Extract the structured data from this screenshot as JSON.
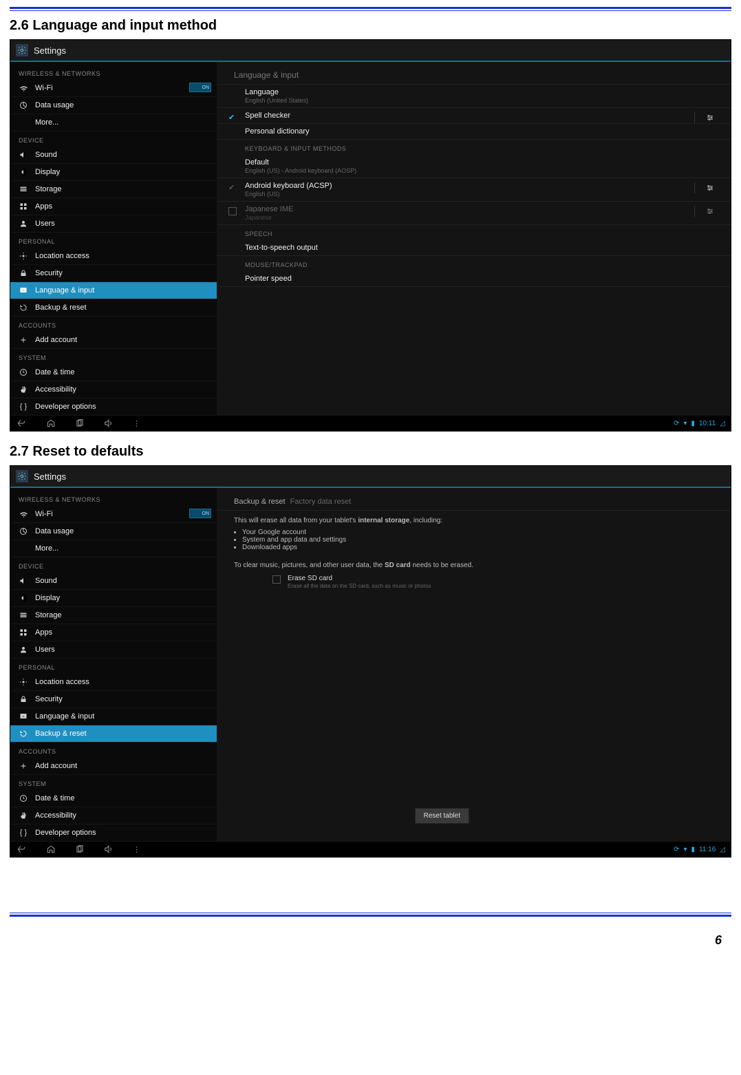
{
  "doc": {
    "heading1": "2.6 Language and input method",
    "heading2": "2.7 Reset to defaults",
    "page_number": "6"
  },
  "shot1": {
    "title": "Settings",
    "time": "10:11",
    "sidebar": {
      "cat_wireless": "WIRELESS & NETWORKS",
      "wifi": "Wi-Fi",
      "wifi_toggle": "ON",
      "data_usage": "Data usage",
      "more": "More...",
      "cat_device": "DEVICE",
      "sound": "Sound",
      "display": "Display",
      "storage": "Storage",
      "apps": "Apps",
      "users": "Users",
      "cat_personal": "PERSONAL",
      "location": "Location access",
      "security": "Security",
      "language": "Language & input",
      "backup": "Backup & reset",
      "cat_accounts": "ACCOUNTS",
      "add_account": "Add account",
      "cat_system": "SYSTEM",
      "datetime": "Date & time",
      "accessibility": "Accessibility",
      "developer": "Developer options"
    },
    "content": {
      "header": "Language & input",
      "language_label": "Language",
      "language_value": "English (United States)",
      "spell_checker": "Spell checker",
      "personal_dictionary": "Personal dictionary",
      "cat_keyboard": "KEYBOARD & INPUT METHODS",
      "default_label": "Default",
      "default_value": "English (US) - Android keyboard (AOSP)",
      "kb1_label": "Android keyboard (ACSP)",
      "kb1_sub": "English (US)",
      "kb2_label": "Japanese IME",
      "kb2_sub": "Japanese",
      "cat_speech": "SPEECH",
      "tts": "Text-to-speech output",
      "cat_mouse": "MOUSE/TRACKPAD",
      "pointer_speed": "Pointer speed"
    }
  },
  "shot2": {
    "title": "Settings",
    "time": "11:16",
    "sidebar": {
      "cat_wireless": "WIRELESS & NETWORKS",
      "wifi": "Wi-Fi",
      "wifi_toggle": "ON",
      "data_usage": "Data usage",
      "more": "More...",
      "cat_device": "DEVICE",
      "sound": "Sound",
      "display": "Display",
      "storage": "Storage",
      "apps": "Apps",
      "users": "Users",
      "cat_personal": "PERSONAL",
      "location": "Location access",
      "security": "Security",
      "language": "Language & input",
      "backup": "Backup & reset",
      "cat_accounts": "ACCOUNTS",
      "add_account": "Add account",
      "cat_system": "SYSTEM",
      "datetime": "Date & time",
      "accessibility": "Accessibility",
      "developer": "Developer options"
    },
    "content": {
      "breadcrumb1": "Backup & reset",
      "breadcrumb2": "Factory data reset",
      "para1_a": "This will erase all data from your tablet's ",
      "para1_b": "internal storage",
      "para1_c": ", including:",
      "b1": "Your Google account",
      "b2": "System and app data and settings",
      "b3": "Downloaded apps",
      "para2_a": "To clear music, pictures, and other user data, the ",
      "para2_b": "SD card",
      "para2_c": " needs to be erased.",
      "erase_label": "Erase SD card",
      "erase_sub": "Erase all the data on the SD card, such as music or photos",
      "reset_button": "Reset tablet"
    }
  }
}
